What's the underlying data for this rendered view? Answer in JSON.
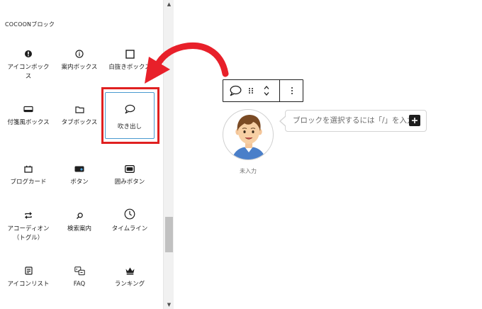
{
  "inserter": {
    "section_title": "COCOONブロック",
    "blocks": [
      {
        "label": "アイコンボックス",
        "icon": "alert-circle-icon"
      },
      {
        "label": "案内ボックス",
        "icon": "info-circle-icon"
      },
      {
        "label": "白抜きボックス",
        "icon": "square-outline-icon"
      },
      {
        "label": "付箋風ボックス",
        "icon": "sticky-note-icon"
      },
      {
        "label": "タブボックス",
        "icon": "folder-icon"
      },
      {
        "label": "吹き出し",
        "icon": "speech-bubble-icon"
      },
      {
        "label": "ブログカード",
        "icon": "card-icon"
      },
      {
        "label": "ボタン",
        "icon": "button-icon"
      },
      {
        "label": "囲みボタン",
        "icon": "framed-button-icon"
      },
      {
        "label": "アコーディオン（トグル）",
        "icon": "toggle-icon"
      },
      {
        "label": "検索案内",
        "icon": "search-icon"
      },
      {
        "label": "タイムライン",
        "icon": "clock-icon"
      },
      {
        "label": "アイコンリスト",
        "icon": "list-icon"
      },
      {
        "label": "FAQ",
        "icon": "faq-icon"
      },
      {
        "label": "ランキング",
        "icon": "crown-icon"
      }
    ],
    "selected_block": "吹き出し"
  },
  "editor": {
    "avatar_caption": "未入力",
    "balloon_placeholder": "ブロックを選択するには「/」を入力",
    "toolbar": {
      "block_type_icon": "speech-bubble-icon",
      "drag_icon": "drag-handle-icon",
      "move_icon": "up-down-chevron-icon",
      "options_icon": "more-vertical-icon"
    },
    "add_block_icon": "plus-icon"
  },
  "colors": {
    "highlight": "#e02020",
    "selected_border": "#4a9ad0",
    "arrow": "#e8202a"
  }
}
